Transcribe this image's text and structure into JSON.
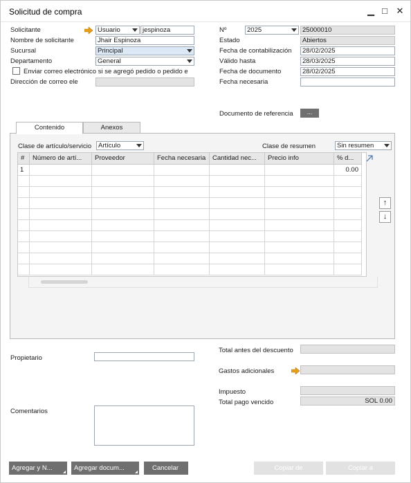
{
  "window": {
    "title": "Solicitud de compra"
  },
  "header_left": {
    "solicitante_label": "Solicitante",
    "solicitante_type": "Usuario",
    "solicitante_code": "jespinoza",
    "nombre_label": "Nombre de solicitante",
    "nombre_value": "Jhair Espinoza",
    "sucursal_label": "Sucursal",
    "sucursal_value": "Principal",
    "departamento_label": "Departamento",
    "departamento_value": "General",
    "correo_check_label": "Enviar correo electrónico si se agregó pedido o pedido e",
    "direccion_label": "Dirección de correo ele",
    "direccion_value": ""
  },
  "header_right": {
    "no_label": "Nº",
    "serie_value": "2025",
    "numero_value": "25000010",
    "estado_label": "Estado",
    "estado_value": "Abiertos",
    "fecha_contab_label": "Fecha de contabilización",
    "fecha_contab_value": "28/02/2025",
    "valido_label": "Válido hasta",
    "valido_value": "28/03/2025",
    "fecha_doc_label": "Fecha de documento",
    "fecha_doc_value": "28/02/2025",
    "fecha_nec_label": "Fecha necesaria",
    "fecha_nec_value": "",
    "doc_ref_label": "Documento de referencia",
    "doc_ref_button": "..."
  },
  "tabs": [
    {
      "label": "Contenido",
      "active": true
    },
    {
      "label": "Anexos",
      "active": false
    }
  ],
  "content": {
    "clase_articulo_label": "Clase de artículo/servicio",
    "clase_articulo_value": "Artículo",
    "clase_resumen_label": "Clase de resumen",
    "clase_resumen_value": "Sin resumen"
  },
  "table": {
    "columns": [
      "#",
      "Número de artí...",
      "Proveedor",
      "Fecha necesaria",
      "Cantidad nec...",
      "Precio info",
      "% d..."
    ],
    "rows": [
      [
        "1",
        "",
        "",
        "",
        "",
        "",
        "0.00"
      ]
    ]
  },
  "footer_left": {
    "propietario_label": "Propietario",
    "propietario_value": "",
    "comentarios_label": "Comentarios",
    "comentarios_value": ""
  },
  "footer_right": {
    "total_antes_label": "Total antes del descuento",
    "total_antes_value": "",
    "gastos_label": "Gastos adicionales",
    "gastos_value": "",
    "impuesto_label": "Impuesto",
    "impuesto_value": "",
    "total_pago_label": "Total pago vencido",
    "total_pago_value": "SOL 0.00"
  },
  "buttons": {
    "agregar_y_nuevo": "Agregar y N...",
    "agregar_documento": "Agregar docum...",
    "cancelar": "Cancelar",
    "copiar_de": "Copiar de",
    "copiar_a": "Copiar a"
  },
  "colors": {
    "accent_orange": "#e8a019",
    "button_gray": "#6f6f6f",
    "disabled_gray": "#e2e2e2"
  }
}
